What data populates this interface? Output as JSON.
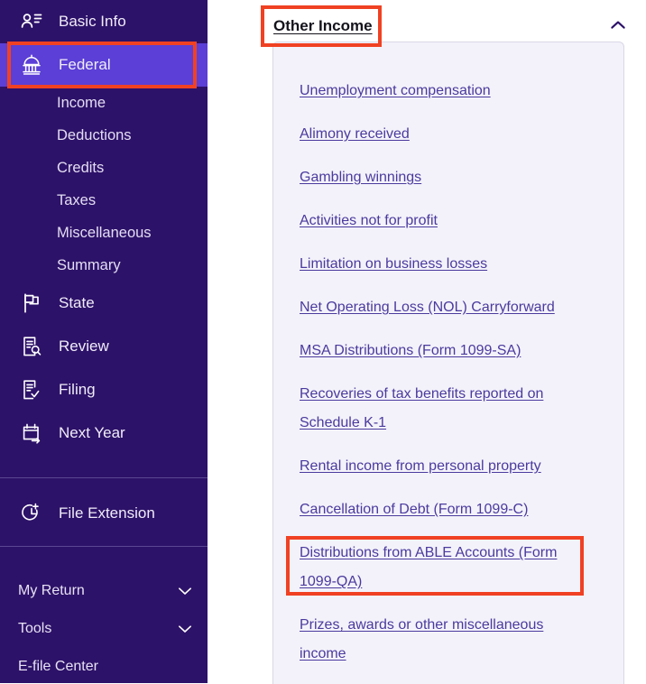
{
  "sidebar": {
    "background_color": "#2d1269",
    "active_color": "#5b3fd6",
    "items": [
      {
        "label": "Basic Info",
        "icon": "person-list-icon",
        "active": false
      },
      {
        "label": "Federal",
        "icon": "capitol-building-icon",
        "active": true
      },
      {
        "label": "State",
        "icon": "flag-icon",
        "active": false
      },
      {
        "label": "Review",
        "icon": "document-magnifier-icon",
        "active": false
      },
      {
        "label": "Filing",
        "icon": "document-check-icon",
        "active": false
      },
      {
        "label": "Next Year",
        "icon": "calendar-arrow-icon",
        "active": false
      }
    ],
    "federal_subitems": [
      {
        "label": "Income"
      },
      {
        "label": "Deductions"
      },
      {
        "label": "Credits"
      },
      {
        "label": "Taxes"
      },
      {
        "label": "Miscellaneous"
      },
      {
        "label": "Summary"
      }
    ],
    "file_extension": {
      "label": "File Extension",
      "icon": "clock-plus-icon"
    },
    "footer_items": [
      {
        "label": "My Return",
        "icon": "chevron-down-icon",
        "expandable": true
      },
      {
        "label": "Tools",
        "icon": "chevron-down-icon",
        "expandable": true
      },
      {
        "label": "E-file Center",
        "expandable": false
      }
    ]
  },
  "main": {
    "section": {
      "title": "Other Income",
      "collapse_icon": "chevron-up-icon",
      "expanded": true
    },
    "links": [
      {
        "label": "Unemployment compensation"
      },
      {
        "label": "Alimony received"
      },
      {
        "label": "Gambling winnings"
      },
      {
        "label": "Activities not for profit"
      },
      {
        "label": "Limitation on business losses"
      },
      {
        "label": "Net Operating Loss (NOL) Carryforward"
      },
      {
        "label": "MSA Distributions (Form 1099-SA)"
      },
      {
        "label": "Recoveries of tax benefits reported on Schedule K-1"
      },
      {
        "label": "Rental income from personal property"
      },
      {
        "label": "Cancellation of Debt (Form 1099-C)"
      },
      {
        "label": "Distributions from ABLE Accounts (Form 1099-QA)"
      },
      {
        "label": "Prizes, awards or other miscellaneous income"
      }
    ]
  },
  "annotations": {
    "highlight_color": "#f04123",
    "boxes": [
      {
        "target": "sidebar-item-federal"
      },
      {
        "target": "section-title-other-income"
      },
      {
        "target": "link-distributions-from-able-accounts"
      }
    ]
  }
}
